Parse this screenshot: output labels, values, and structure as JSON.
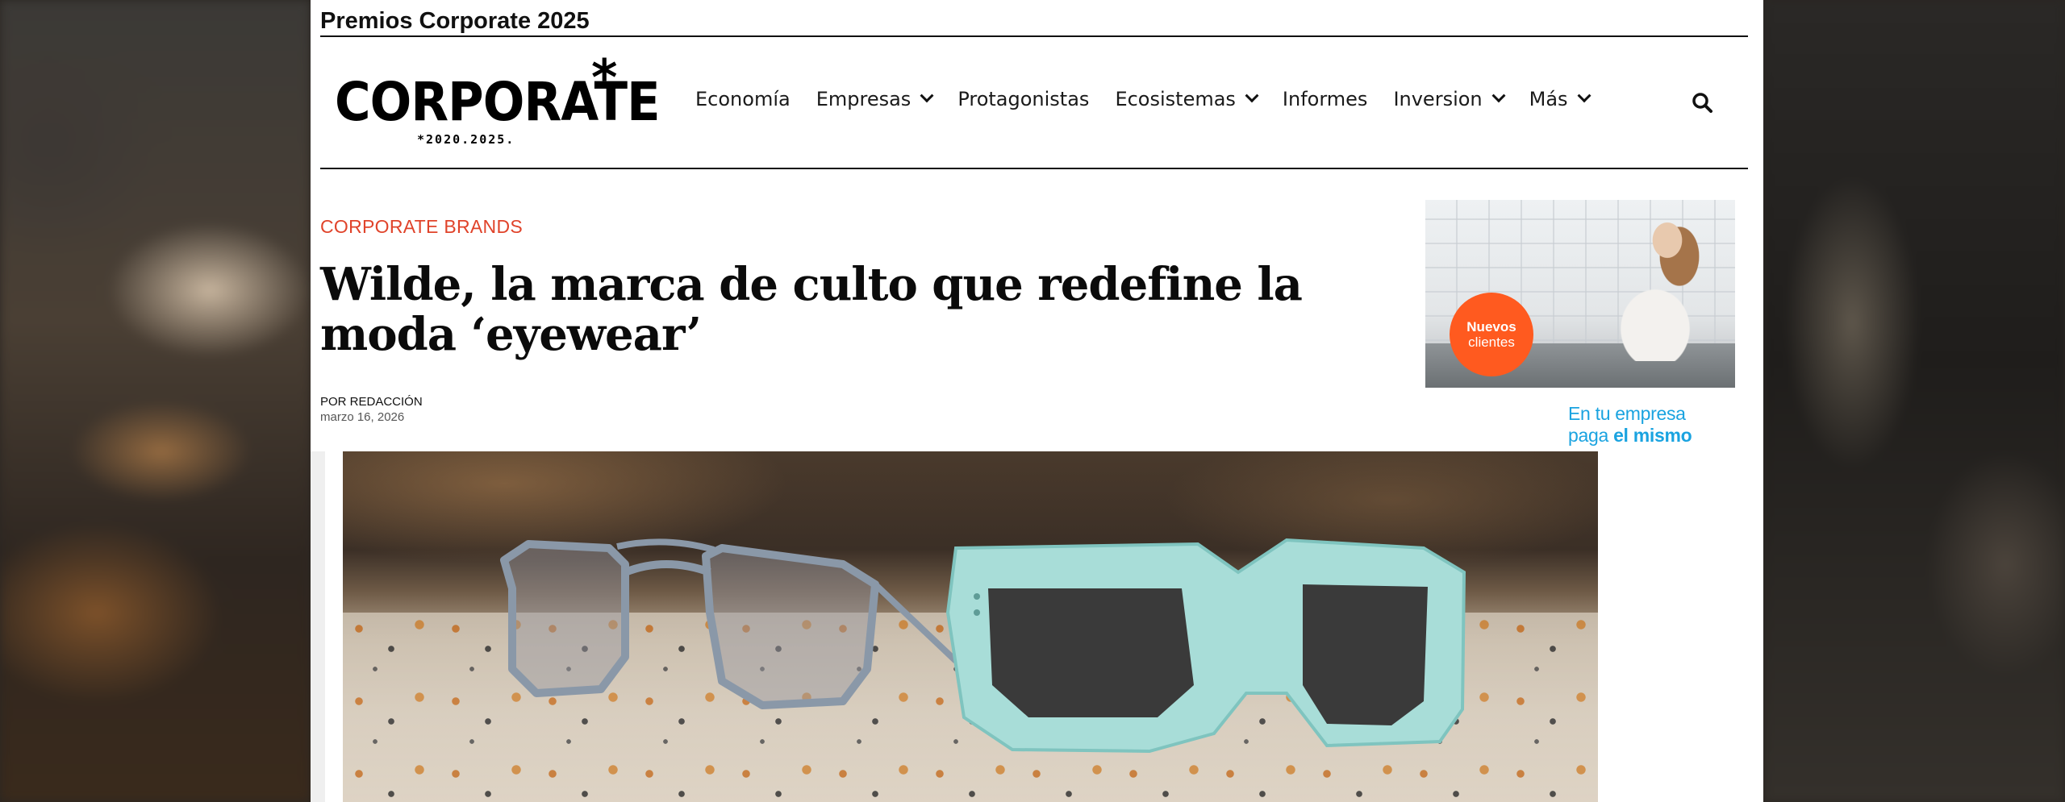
{
  "top_bar": {
    "title": "Premios Corporate 2025"
  },
  "logo": {
    "word": "CORPORATE",
    "star": "*",
    "sub": "*2020.2025."
  },
  "nav": {
    "items": [
      {
        "label": "Economía",
        "dropdown": false
      },
      {
        "label": "Empresas",
        "dropdown": true
      },
      {
        "label": "Protagonistas",
        "dropdown": false
      },
      {
        "label": "Ecosistemas",
        "dropdown": true
      },
      {
        "label": "Informes",
        "dropdown": false
      },
      {
        "label": "Inversion",
        "dropdown": true
      },
      {
        "label": "Más",
        "dropdown": true
      }
    ],
    "search_icon": "search-icon"
  },
  "article": {
    "category": "CORPORATE BRANDS",
    "headline": "Wilde, la marca de culto que redefine la moda ‘eyewear’",
    "byline": "POR REDACCIÓN",
    "date": "marzo 16, 2026"
  },
  "ad": {
    "badge_line1": "Nuevos",
    "badge_line2": "clientes",
    "text_line1": "En tu empresa",
    "text_line2_prefix": "paga",
    "text_line2_emphasis": "el mismo"
  },
  "colors": {
    "category": "#e0432a",
    "ad_badge": "#ff5a1f",
    "ad_text": "#1aa3e0",
    "glasses_blue": "#a8ddd8"
  }
}
